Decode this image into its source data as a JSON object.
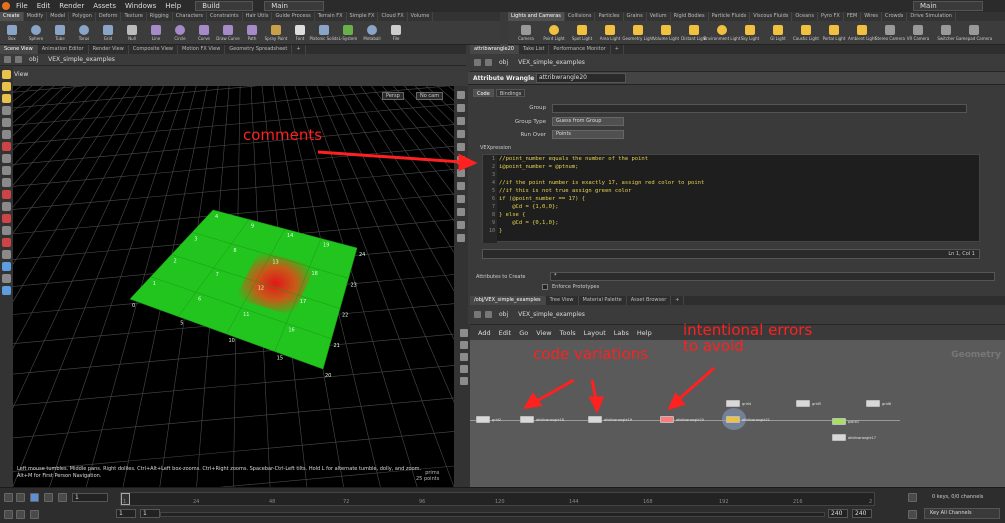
{
  "menubar": {
    "items": [
      "File",
      "Edit",
      "Render",
      "Assets",
      "Windows",
      "Help"
    ],
    "build": "Build",
    "main": "Main",
    "main_right": "Main"
  },
  "shelf_left_tabs": [
    "Create",
    "Modify",
    "Model",
    "Polygon",
    "Deform",
    "Texture",
    "Rigging",
    "Characters",
    "Constraints",
    "Hair Utils",
    "Guide Process",
    "Terrain FX",
    "Simple FX",
    "Cloud FX",
    "Volume"
  ],
  "shelf_right_tabs": [
    "Lights and Cameras",
    "Collisions",
    "Particles",
    "Grains",
    "Vellum",
    "Rigid Bodies",
    "Particle Fluids",
    "Viscous Fluids",
    "Oceans",
    "Pyro FX",
    "FEM",
    "Wires",
    "Crowds",
    "Drive Simulation"
  ],
  "shelf_left_tools": [
    "Box",
    "Sphere",
    "Tube",
    "Torus",
    "Grid",
    "Null",
    "Line",
    "Circle",
    "Curve",
    "Draw Curve",
    "Path",
    "Spray Paint",
    "Font",
    "Platonic Solids",
    "L-System",
    "Metaball",
    "File"
  ],
  "shelf_right_tools": [
    "Camera",
    "Point Light",
    "Spot Light",
    "Area Light",
    "Geometry Light",
    "Volume Light",
    "Distant Light",
    "Environment Light",
    "Sky Light",
    "GI Light",
    "Caustic Light",
    "Portal Light",
    "Ambient Light",
    "Stereo Camera",
    "VR Camera",
    "Switcher",
    "Gamepad Camera"
  ],
  "left_pane_tabs": [
    "Scene View",
    "Animation Editor",
    "Render View",
    "Composite View",
    "Motion FX View",
    "Geometry Spreadsheet"
  ],
  "right_pane_tabs": [
    "attribwrangle20",
    "Take List",
    "Performance Monitor"
  ],
  "path": {
    "root": "obj",
    "node": "VEX_simple_examples"
  },
  "viewport": {
    "title": "View",
    "persp": "Persp",
    "cam": "No cam",
    "help": "Left mouse tumbles. Middle pans. Right dollies. Ctrl+Alt+Left box-zooms. Ctrl+Right zooms. Spacebar-Ctrl-Left tilts. Hold L for alternate tumble, dolly, and zoom.  Alt+M for First Person Navigation.",
    "prims": "prims",
    "points": "25 points",
    "point_labels": [
      "0",
      "1",
      "2",
      "3",
      "4",
      "5",
      "6",
      "7",
      "8",
      "9",
      "10",
      "11",
      "12",
      "13",
      "14",
      "15",
      "16",
      "17",
      "18",
      "19",
      "20",
      "21",
      "22",
      "23",
      "24"
    ]
  },
  "params": {
    "node_type": "Attribute Wrangle",
    "node_name": "attribwrangle20",
    "tabs": [
      "Code",
      "Bindings"
    ],
    "group_label": "Group",
    "group_value": "",
    "group_type_label": "Group Type",
    "group_type_value": "Guess from Group",
    "run_over_label": "Run Over",
    "run_over_value": "Points",
    "vex_label": "VEXpression",
    "code_lines": [
      "//point_number equals the number of the point",
      "i@point_number = @ptnum;",
      "",
      "//if the point number is exactly 17, assign red color to point",
      "//if this is not true assign green color",
      "if (@point_number == 17) {",
      "    @Cd = {1,0,0};",
      "} else {",
      "    @Cd = {0,1,0};",
      "}"
    ],
    "line_numbers": [
      "1",
      "2",
      "3",
      "4",
      "5",
      "6",
      "7",
      "8",
      "9",
      "10"
    ],
    "status": "Ln 1, Col 1",
    "attrs_label": "Attributes to Create",
    "attrs_value": "*",
    "enforce": "Enforce Prototypes"
  },
  "network_tabs": [
    "/obj/VEX_simple_examples",
    "Tree View",
    "Material Palette",
    "Asset Browser"
  ],
  "network_menu": [
    "Add",
    "Edit",
    "Go",
    "View",
    "Tools",
    "Layout",
    "Labs",
    "Help"
  ],
  "network": {
    "watermark": "Geometry",
    "nodes": [
      {
        "label": "attribwrangle18",
        "color": "#d8d8d8"
      },
      {
        "label": "attribwrangle19",
        "color": "#d8d8d8"
      },
      {
        "label": "attribwrangle20",
        "color": "#ff7a7a"
      },
      {
        "label": "attribwrangle21",
        "color": "#e8c440"
      },
      {
        "label": "grid4",
        "color": "#d8d8d8"
      },
      {
        "label": "grid5",
        "color": "#d8d8d8"
      },
      {
        "label": "grid6",
        "color": "#d8d8d8"
      },
      {
        "label": "point1",
        "color": "#a8e060"
      },
      {
        "label": "attribwrangle17",
        "color": "#d8d8d8"
      },
      {
        "label": "grid2",
        "color": "#d8d8d8"
      }
    ]
  },
  "timeline": {
    "frame": "1",
    "start": "1",
    "start2": "1",
    "end": "240",
    "end2": "240",
    "ticks": [
      "1",
      "24",
      "48",
      "72",
      "96",
      "120",
      "144",
      "168",
      "192",
      "216",
      "2"
    ],
    "keys": "0 keys, 0/0 channels",
    "all_channels": "Key All Channels"
  },
  "annotations": {
    "comments": "comments",
    "code_variations": "code variations",
    "errors": "intentional errors\nto avoid"
  },
  "colors": {
    "grid_green": "#22c41e",
    "red_point": "#e01818",
    "annotation": "#ff2020"
  }
}
